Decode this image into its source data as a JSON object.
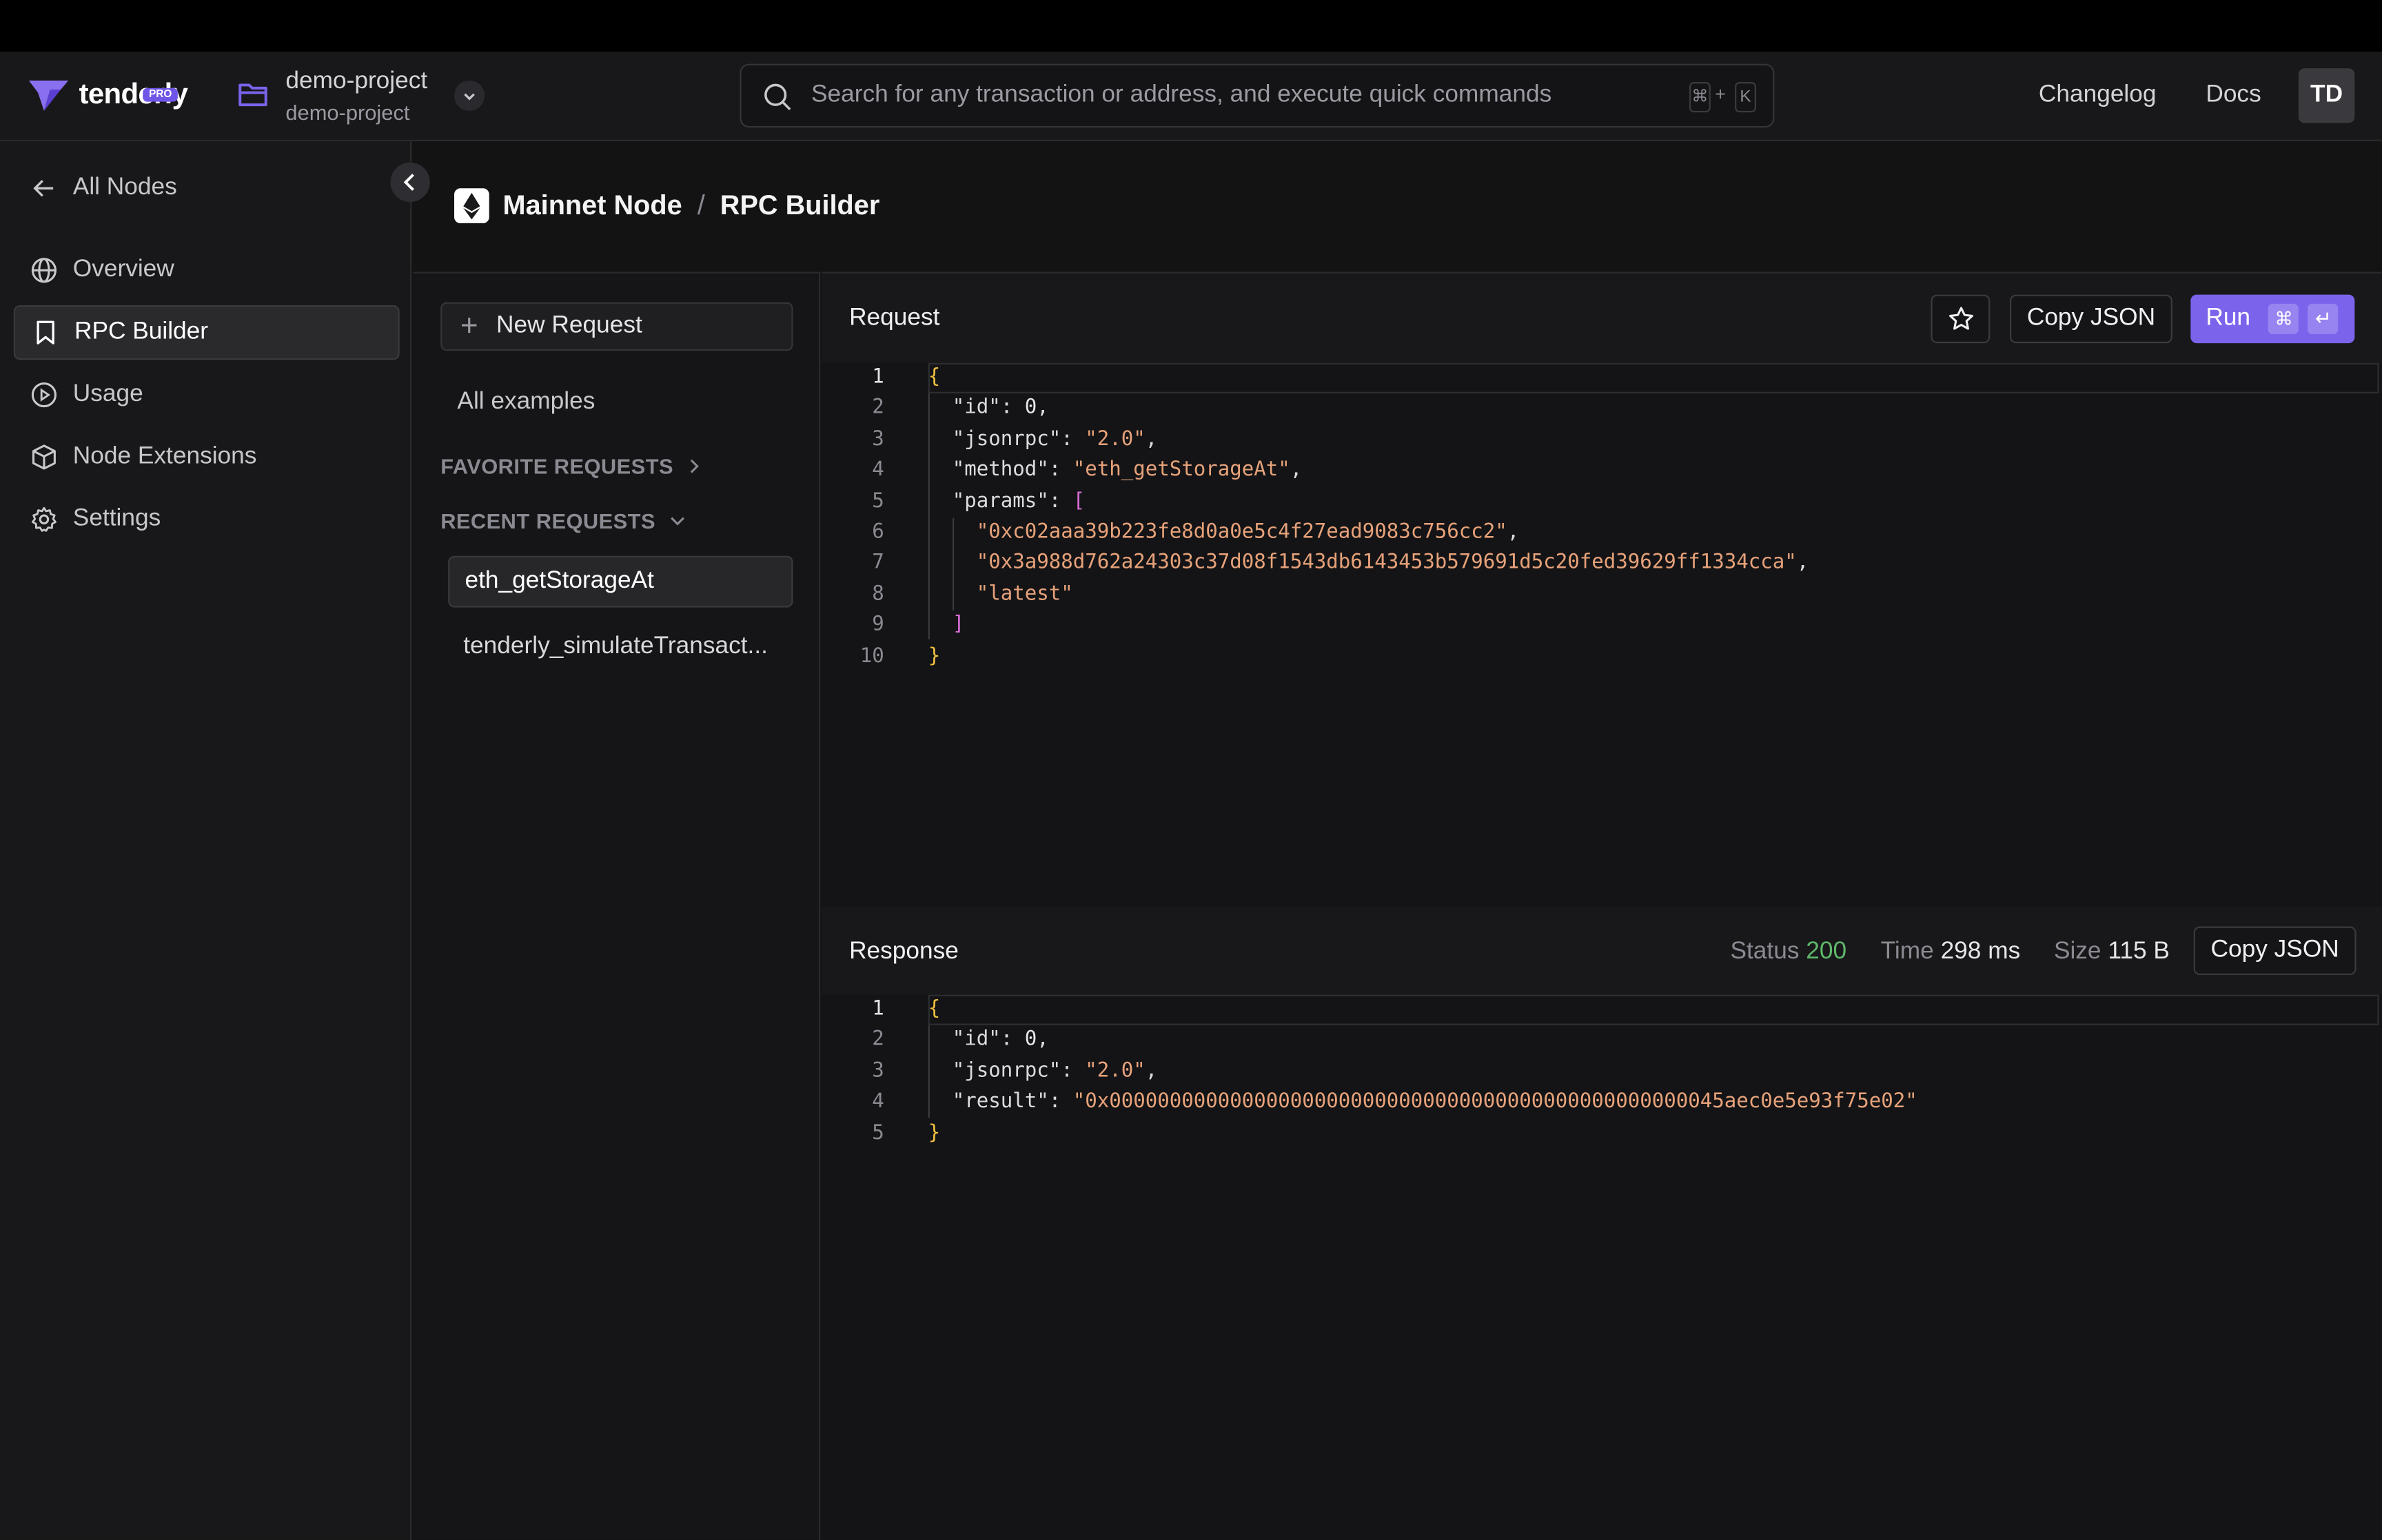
{
  "app": {
    "brand": "tenderly",
    "badge": "PRO"
  },
  "project": {
    "name": "demo-project",
    "subtitle": "demo-project"
  },
  "search": {
    "placeholder": "Search for any transaction or address, and execute quick commands",
    "kbd_mod": "⌘",
    "kbd_plus": "+",
    "kbd_key": "K"
  },
  "header_nav": {
    "changelog": "Changelog",
    "docs": "Docs",
    "avatar": "TD"
  },
  "sidebar": {
    "back": "All Nodes",
    "items": [
      {
        "label": "Overview",
        "icon": "globe-icon"
      },
      {
        "label": "RPC Builder",
        "icon": "bookmark-icon",
        "active": true
      },
      {
        "label": "Usage",
        "icon": "play-circle-icon"
      },
      {
        "label": "Node Extensions",
        "icon": "cube-icon"
      },
      {
        "label": "Settings",
        "icon": "gear-icon"
      }
    ]
  },
  "breadcrumb": {
    "node": "Mainnet Node",
    "separator": "/",
    "page": "RPC Builder"
  },
  "requests_panel": {
    "new_request": "New Request",
    "all_examples": "All examples",
    "favorites_title": "FAVORITE REQUESTS",
    "recent_title": "RECENT REQUESTS",
    "recent": [
      "eth_getStorageAt",
      "tenderly_simulateTransact..."
    ]
  },
  "request": {
    "title": "Request",
    "copy_json": "Copy JSON",
    "run": "Run",
    "run_shortcut_mod": "⌘",
    "run_shortcut_key": "↵",
    "line_numbers": [
      "1",
      "2",
      "3",
      "4",
      "5",
      "6",
      "7",
      "8",
      "9",
      "10"
    ],
    "id_key": "\"id\"",
    "id_value": "0",
    "jsonrpc_key": "\"jsonrpc\"",
    "jsonrpc_value": "\"2.0\"",
    "method_key": "\"method\"",
    "method_value": "\"eth_getStorageAt\"",
    "params_key": "\"params\"",
    "params": [
      "\"0xc02aaa39b223fe8d0a0e5c4f27ead9083c756cc2\"",
      "\"0x3a988d762a24303c37d08f1543db6143453b579691d5c20fed39629ff1334cca\"",
      "\"latest\""
    ]
  },
  "response": {
    "title": "Response",
    "status_label": "Status",
    "status_value": "200",
    "time_label": "Time",
    "time_value": "298 ms",
    "size_label": "Size",
    "size_value": "115 B",
    "copy_json": "Copy JSON",
    "line_numbers": [
      "1",
      "2",
      "3",
      "4",
      "5"
    ],
    "id_key": "\"id\"",
    "id_value": "0",
    "jsonrpc_key": "\"jsonrpc\"",
    "jsonrpc_value": "\"2.0\"",
    "result_key": "\"result\"",
    "result_value": "\"0x000000000000000000000000000000000000000000000000045aec0e5e93f75e02\""
  },
  "colors": {
    "accent": "#7c63ec",
    "status_ok": "#5fb86b",
    "string": "#e7a27a",
    "bracket_outer": "#f0c040",
    "bracket_inner": "#d86fd8"
  }
}
